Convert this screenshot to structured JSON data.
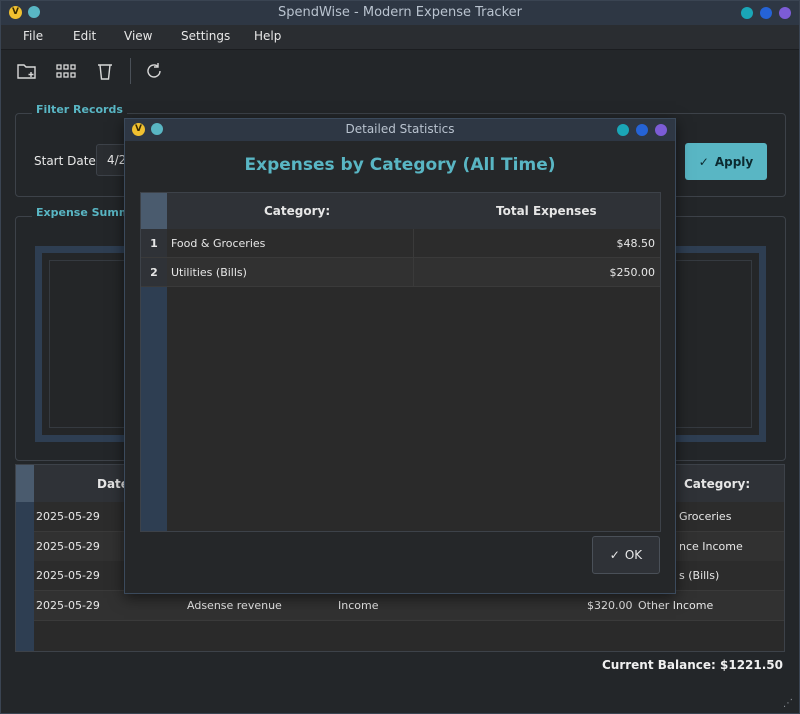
{
  "window": {
    "title": "SpendWise - Modern Expense Tracker",
    "app_icon_glyph": "V",
    "controls": [
      "#1aa6b7",
      "#2563d6",
      "#7c5cd6"
    ]
  },
  "menu": {
    "items": [
      {
        "label": "File"
      },
      {
        "label": "Edit"
      },
      {
        "label": "View"
      },
      {
        "label": "Settings"
      },
      {
        "label": "Help"
      }
    ]
  },
  "toolbar": {
    "icons": [
      "new-folder-icon",
      "grid-icon",
      "trash-icon",
      "refresh-icon"
    ]
  },
  "filter": {
    "group_title": "Filter Records",
    "start_date_label": "Start Date:",
    "start_date_value": "4/2",
    "apply_label": "Apply"
  },
  "summary": {
    "group_title": "Expense Summa"
  },
  "records": {
    "headers": {
      "date": "Date",
      "category": "Category:"
    },
    "rows": [
      {
        "date": "2025-05-29",
        "description": "",
        "type": "",
        "amount": "",
        "category": "Groceries"
      },
      {
        "date": "2025-05-29",
        "description": "",
        "type": "",
        "amount": "",
        "category": "nce Income"
      },
      {
        "date": "2025-05-29",
        "description": "",
        "type": "",
        "amount": "",
        "category": "s (Bills)"
      },
      {
        "date": "2025-05-29",
        "description": "Adsense revenue",
        "type": "Income",
        "amount": "$320.00",
        "category": "Other Income"
      }
    ]
  },
  "balance": {
    "text": "Current Balance: $1221.50"
  },
  "dialog": {
    "title": "Detailed Statistics",
    "heading": "Expenses by Category (All Time)",
    "headers": {
      "category": "Category:",
      "total": "Total Expenses"
    },
    "rows": [
      {
        "num": "1",
        "category": "Food & Groceries",
        "total": "$48.50"
      },
      {
        "num": "2",
        "category": "Utilities (Bills)",
        "total": "$250.00"
      }
    ],
    "ok_label": "OK"
  },
  "colors": {
    "accent": "#59b6c4",
    "titlebar": "#2e3744",
    "background": "#232629"
  }
}
